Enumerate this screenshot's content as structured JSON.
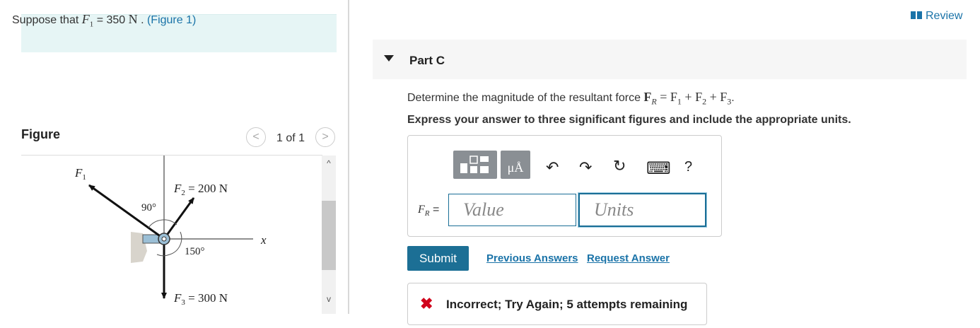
{
  "intro": {
    "prefix": "Suppose that",
    "var": "F",
    "sub": "1",
    "eq": " = 350 ",
    "unit": "N",
    "dot": " . ",
    "figure_link": "(Figure 1)"
  },
  "figure": {
    "title": "Figure",
    "pager": "1 of 1",
    "prev": "<",
    "next": ">",
    "labels": {
      "f1": "F",
      "f1_sub": "1",
      "f2": "F",
      "f2_sub": "2",
      "f2_val": " = 200 N",
      "f3": "F",
      "f3_sub": "3",
      "f3_val": " = 300 N",
      "angle90": "90°",
      "angle150": "150°",
      "x_axis": "x"
    }
  },
  "scrollbar": {
    "up": "^",
    "down": "v"
  },
  "review": {
    "label": "Review"
  },
  "part": {
    "title": "Part C"
  },
  "question": {
    "text": "Determine the magnitude of the resultant force ",
    "math": "F",
    "sub": "R",
    "rest": " = F",
    "s1": "1",
    "plus1": " + F",
    "s2": "2",
    "plus2": " + F",
    "s3": "3",
    "end": "."
  },
  "instructions": "Express your answer to three significant figures and include the appropriate units.",
  "toolbar": {
    "unit_symbol": "μÅ",
    "undo": "↶",
    "redo": "↷",
    "reset": "↻",
    "keyboard": "⌨",
    "help": "?"
  },
  "answer": {
    "label": "F",
    "label_sub": "R",
    "label_eq": " =",
    "value_placeholder": "Value",
    "units_placeholder": "Units"
  },
  "actions": {
    "submit": "Submit",
    "previous": "Previous Answers",
    "request": "Request Answer"
  },
  "feedback": {
    "icon": "✖",
    "text": "Incorrect; Try Again; 5 attempts remaining"
  },
  "colors": {
    "accent": "#1c6f95",
    "link": "#1a73a8",
    "intro_bg": "#e6f5f5",
    "error": "#d0021b"
  }
}
